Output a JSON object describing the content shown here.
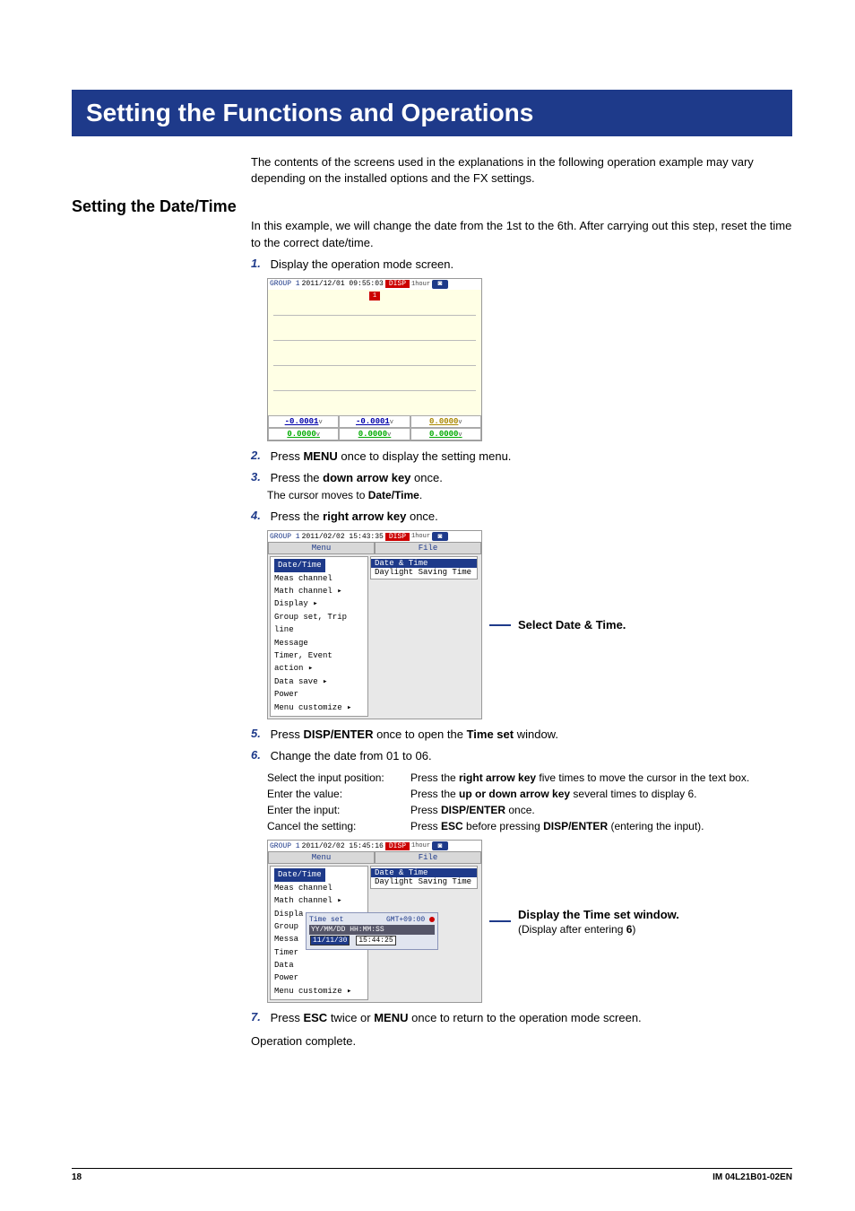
{
  "banner": "Setting the Functions and Operations",
  "intro": "The contents of the screens used in the explanations in the following operation example may vary depending on the installed options and the FX settings.",
  "section_title": "Setting the Date/Time",
  "section_intro": "In this example, we will change the date from the 1st to the 6th. After carrying out this step, reset the time to the correct date/time.",
  "steps": {
    "s1": {
      "n": "1.",
      "t": "Display the operation mode screen."
    },
    "s2": {
      "n": "2.",
      "t1": "Press ",
      "b": "MENU",
      "t2": " once to display the setting menu."
    },
    "s3": {
      "n": "3.",
      "t1": "Press the ",
      "b": "down arrow key",
      "t2": " once.",
      "sub1": "The cursor moves to ",
      "sub_b": "Date/Time",
      "sub2": "."
    },
    "s4": {
      "n": "4.",
      "t1": "Press the ",
      "b": "right arrow key",
      "t2": " once."
    },
    "s5": {
      "n": "5.",
      "t1": "Press ",
      "b": "DISP/ENTER",
      "t2": " once to open the ",
      "b2": "Time set",
      "t3": " window."
    },
    "s6": {
      "n": "6.",
      "t": "Change the date from 01 to 06."
    },
    "s7": {
      "n": "7.",
      "t1": "Press ",
      "b": "ESC",
      "t2": " twice or ",
      "b2": "MENU",
      "t3": " once to return to the operation mode screen."
    }
  },
  "kv": {
    "r1": {
      "l": "Select the input position:",
      "v1": "Press the ",
      "b": "right arrow key",
      "v2": " five times to move the cursor in the text box."
    },
    "r2": {
      "l": "Enter the value:",
      "v1": "Press the ",
      "b": "up or down arrow key",
      "v2": " several times to display 6."
    },
    "r3": {
      "l": "Enter the input:",
      "v1": "Press ",
      "b": "DISP/ENTER",
      "v2": " once."
    },
    "r4": {
      "l": "Cancel the setting:",
      "v1": "Press ",
      "b": "ESC",
      "v2": " before pressing ",
      "b2": "DISP/ENTER",
      "v3": " (entering the input)."
    }
  },
  "op_complete": "Operation complete.",
  "scr1": {
    "hdr_group": "GROUP 1",
    "hdr_ts": "2011/12/01 09:55:03",
    "disp": "DISP",
    "hour": "1hour",
    "tag": "1",
    "r": {
      "a": "-0.0001",
      "b": "-0.0001",
      "c": "0.0000",
      "d": "0.0000",
      "e": "0.0000",
      "f": "0.0000",
      "unit": "v"
    }
  },
  "scr2": {
    "hdr_group": "GROUP 1",
    "hdr_ts": "2011/02/02 15:43:35",
    "disp": "DISP",
    "hour": "1hour",
    "menu": "Menu",
    "file": "File",
    "items": [
      "Date/Time",
      "Meas channel",
      "Math channel",
      "Display",
      "Group set, Trip line",
      "Message",
      "Timer, Event action",
      "Data save",
      "Power",
      "Menu customize"
    ],
    "sub_items": [
      "Date & Time",
      "Daylight Saving Time"
    ],
    "callout": "Select Date & Time."
  },
  "scr3": {
    "hdr_group": "GROUP 1",
    "hdr_ts": "2011/02/02 15:45:16",
    "disp": "DISP",
    "hour": "1hour",
    "menu": "Menu",
    "file": "File",
    "items": [
      "Date/Time",
      "Meas channel",
      "Math channel",
      "Displa",
      "Group",
      "Messa",
      "Timer",
      "Data",
      "Power",
      "Menu customize"
    ],
    "sub_items": [
      "Date & Time",
      "Daylight Saving Time"
    ],
    "time_pop": {
      "title": "Time set",
      "tz": "GMT+09:00",
      "fmt": "YY/MM/DD  HH:MM:SS",
      "date": "11/11/30",
      "time": "15:44:25"
    },
    "callout1": "Display the Time set window.",
    "callout2_a": "(Display after entering ",
    "callout2_b": "6",
    "callout2_c": ")"
  },
  "footer": {
    "page": "18",
    "doc": "IM 04L21B01-02EN"
  }
}
